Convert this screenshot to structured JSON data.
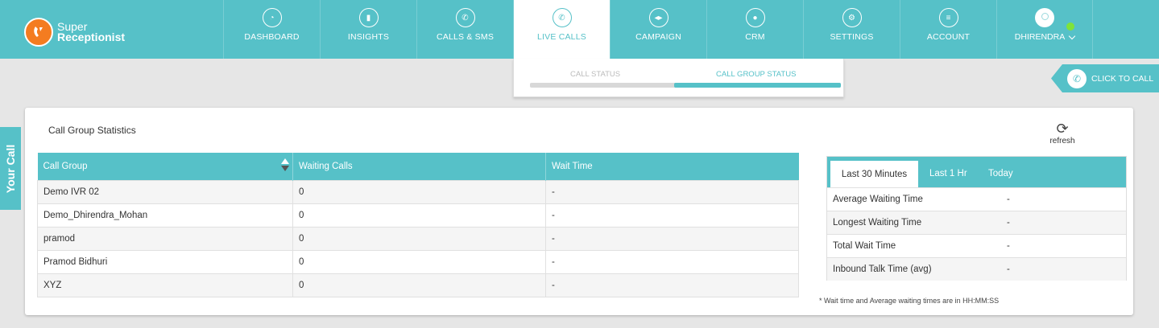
{
  "brand": {
    "line1": "Super",
    "line2": "Receptionist"
  },
  "nav": {
    "items": [
      {
        "label": "DASHBOARD",
        "icon": "dashboard-icon"
      },
      {
        "label": "INSIGHTS",
        "icon": "chart-icon"
      },
      {
        "label": "CALLS & SMS",
        "icon": "phone-icon"
      },
      {
        "label": "LIVE CALLS",
        "icon": "live-call-icon",
        "active": true
      },
      {
        "label": "CAMPAIGN",
        "icon": "megaphone-icon"
      },
      {
        "label": "CRM",
        "icon": "users-icon"
      },
      {
        "label": "SETTINGS",
        "icon": "gear-icon"
      },
      {
        "label": "ACCOUNT",
        "icon": "list-icon"
      }
    ],
    "user": {
      "name": "DHIRENDRA",
      "status_color": "#7fe33a"
    }
  },
  "subtabs": {
    "call_status": "CALL STATUS",
    "call_group_status": "CALL GROUP STATUS",
    "active": "CALL GROUP STATUS"
  },
  "click_to_call": "CLICK TO CALL",
  "your_call": "Your Call",
  "card": {
    "title": "Call Group Statistics",
    "refresh": "refresh",
    "table": {
      "headers": [
        "Call Group",
        "Waiting Calls",
        "Wait Time"
      ],
      "rows": [
        [
          "Demo IVR 02",
          "0",
          "-"
        ],
        [
          "Demo_Dhirendra_Mohan",
          "0",
          "-"
        ],
        [
          "pramod",
          "0",
          "-"
        ],
        [
          "Pramod Bidhuri",
          "0",
          "-"
        ],
        [
          "XYZ",
          "0",
          "-"
        ]
      ]
    },
    "stats": {
      "tabs": [
        "Last 30 Minutes",
        "Last 1 Hr",
        "Today"
      ],
      "active_tab": "Last 30 Minutes",
      "rows": [
        {
          "label": "Average Waiting Time",
          "value": "-"
        },
        {
          "label": "Longest Waiting Time",
          "value": "-"
        },
        {
          "label": "Total Wait Time",
          "value": "-"
        },
        {
          "label": "Inbound Talk Time (avg)",
          "value": "-"
        }
      ]
    },
    "note": "* Wait time and Average waiting times are in HH:MM:SS"
  },
  "colors": {
    "accent": "#56c1c8",
    "logo": "#f47c20"
  }
}
